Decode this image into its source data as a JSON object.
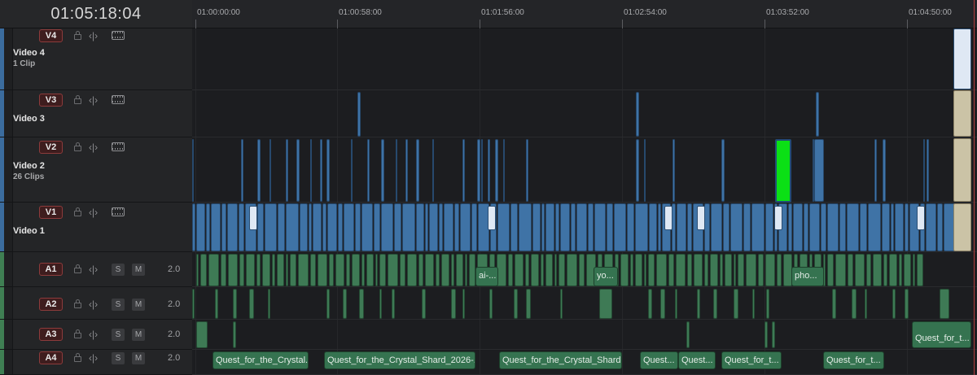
{
  "timecode": "01:05:18:04",
  "ruler": {
    "ticks": [
      "01:00:00:00",
      "01:00:58:00",
      "01:01:56:00",
      "01:02:54:00",
      "01:03:52:00",
      "01:04:50:00"
    ]
  },
  "tracks": {
    "v4": {
      "label": "V4",
      "name": "Video 4",
      "clips": "1 Clip"
    },
    "v3": {
      "label": "V3",
      "name": "Video 3",
      "clips": ""
    },
    "v2": {
      "label": "V2",
      "name": "Video 2",
      "clips": "26 Clips"
    },
    "v1": {
      "label": "V1",
      "name": "Video 1",
      "clips": ""
    },
    "a1": {
      "label": "A1",
      "vol": "2.0",
      "s": "S",
      "m": "M"
    },
    "a2": {
      "label": "A2",
      "vol": "2.0",
      "s": "S",
      "m": "M"
    },
    "a3": {
      "label": "A3",
      "vol": "2.0",
      "s": "S",
      "m": "M"
    },
    "a4": {
      "label": "A4",
      "vol": "2.0",
      "s": "S",
      "m": "M"
    }
  },
  "clip_labels": {
    "a1": [
      "ai-...",
      "yo...",
      "pho..."
    ],
    "a3": [
      "Quest_for_t..."
    ],
    "a4": [
      "Quest_for_the_Crystal...",
      "Quest_for_the_Crystal_Shard_2026-...",
      "Quest_for_the_Crystal_Shard...",
      "Quest...",
      "Quest...",
      "Quest_for_t...",
      "Quest_for_t..."
    ]
  },
  "colors": {
    "video": "#3f73a6",
    "audio": "#3e7a55",
    "playhead": "#b23b3b",
    "track_label_bg": "#3e1d1e"
  }
}
